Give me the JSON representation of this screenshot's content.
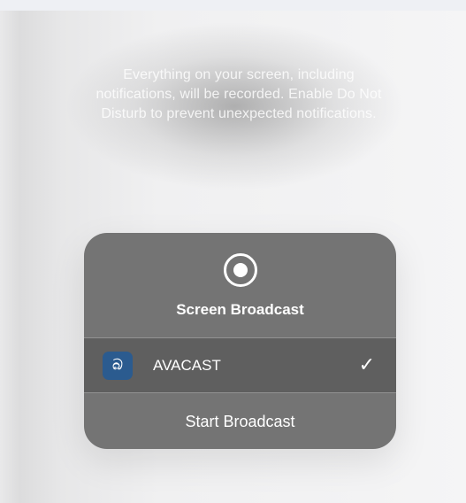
{
  "notice": {
    "text": "Everything on your screen, including notifications, will be recorded. Enable Do Not Disturb to prevent unexpected notifications."
  },
  "panel": {
    "title": "Screen Broadcast",
    "record_icon": "record-icon",
    "app": {
      "name": "AVACAST",
      "icon": "avacast-app-icon",
      "icon_glyph": "බ",
      "selected": true,
      "check_glyph": "✓"
    },
    "start_label": "Start Broadcast"
  },
  "colors": {
    "panel_bg": "#747474",
    "selected_row_bg": "#5f5f5f",
    "app_icon_bg": "#2b5b8f",
    "text": "#ffffff"
  }
}
